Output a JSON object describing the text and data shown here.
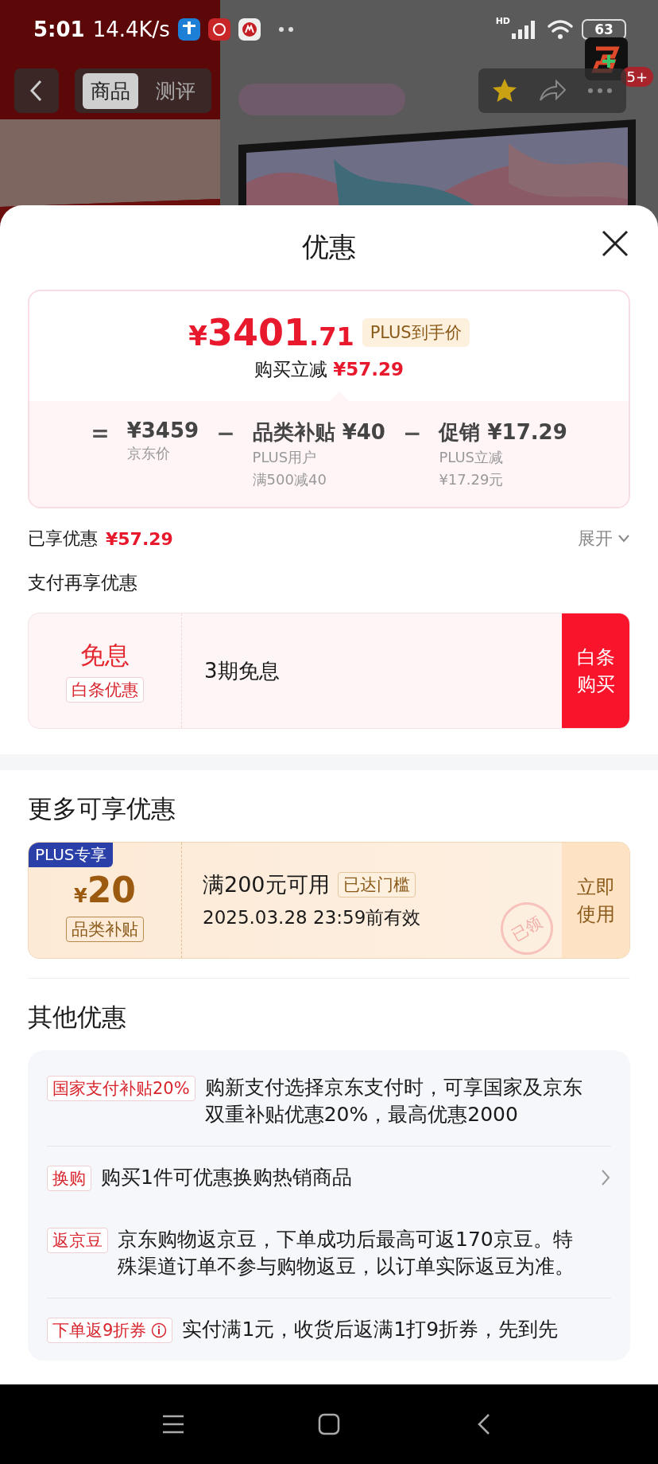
{
  "status_bar": {
    "time": "5:01",
    "speed": "14.4K/s",
    "network": "HD",
    "battery": "63"
  },
  "floating_app": {
    "badge": "5+"
  },
  "nav": {
    "tabs": [
      {
        "label": "商品",
        "selected": true
      },
      {
        "label": "测评",
        "selected": false
      }
    ],
    "favorited": true
  },
  "sheet": {
    "title": "优惠"
  },
  "price_card": {
    "currency": "¥",
    "integer": "3401",
    "decimal": ".71",
    "price_tag": "PLUS到手价",
    "reduce_label": "购买立减",
    "reduce_value": "¥57.29",
    "breakdown": [
      {
        "operator": "=",
        "value": "¥3459",
        "notes": [
          "京东价"
        ]
      },
      {
        "operator": "−",
        "label": "品类补贴",
        "value": "¥40",
        "notes": [
          "PLUS用户",
          "满500减40"
        ]
      },
      {
        "operator": "−",
        "label": "促销",
        "value": "¥17.29",
        "notes": [
          "PLUS立减",
          "¥17.29元"
        ]
      }
    ]
  },
  "enjoyed": {
    "label": "已享优惠",
    "value": "¥57.29",
    "toggle": "展开",
    "expanded": false
  },
  "pay_section": {
    "title": "支付再享优惠",
    "offer": {
      "headline": "免息",
      "tag": "白条优惠",
      "desc": "3期免息",
      "button": "白条购买"
    }
  },
  "more_section": {
    "title": "更多可享优惠",
    "coupon": {
      "badge": "PLUS专享",
      "currency": "¥",
      "amount": "20",
      "tag": "品类补贴",
      "condition": "满200元可用",
      "status": "已达门槛",
      "validity": "2025.03.28 23:59前有效",
      "button": "立即使用",
      "stamp": "已领"
    }
  },
  "other_section": {
    "title": "其他优惠",
    "items": [
      {
        "tag": "国家支付补贴20%",
        "info": false,
        "text": "购新支付选择京东支付时，可享国家及京东双重补贴优惠20%，最高优惠2000",
        "arrow": false,
        "separated": true
      },
      {
        "tag": "换购",
        "info": false,
        "text": "购买1件可优惠换购热销商品",
        "arrow": true,
        "separated": false
      },
      {
        "tag": "返京豆",
        "info": false,
        "text": "京东购物返京豆，下单成功后最高可返170京豆。特殊渠道订单不参与购物返豆，以订单实际返豆为准。",
        "arrow": false,
        "separated": true
      },
      {
        "tag": "下单返9折券",
        "info": true,
        "text": "实付满1元，收货后返满1打9折券，先到先",
        "arrow": false,
        "separated": false
      }
    ]
  }
}
